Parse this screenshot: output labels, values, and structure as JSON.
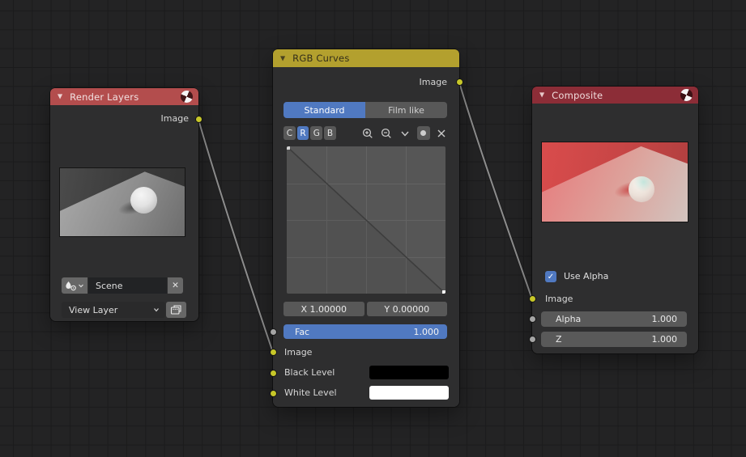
{
  "editor": {
    "type": "blender-compositor-node-editor",
    "background": "#232324",
    "grid_line": "#1b1b1c"
  },
  "colors": {
    "accent_blue": "#5079c1",
    "socket_yellow": "#c7c729",
    "socket_gray": "#a5a5a5",
    "node_body": "#2f2f30",
    "header_render_layers": "#b34d4d",
    "header_rgb_curves": "#b3a02e",
    "header_composite": "#8c2d37",
    "wire": "#8d8d8d",
    "black_level_swatch": "#000000",
    "white_level_swatch": "#ffffff"
  },
  "icons": {
    "collapse": "▼",
    "close": "✕",
    "check": "✓"
  },
  "links": [
    {
      "from": "render_layers.Image",
      "to": "rgb_curves.Image"
    },
    {
      "from": "rgb_curves.Image",
      "to": "composite.Image"
    }
  ],
  "nodes": {
    "render_layers": {
      "title": "Render Layers",
      "outputs": [
        {
          "label": "Image",
          "socket_color": "#c7c729"
        }
      ],
      "preview": "grayscale 3d scene: white sphere with shadow on gray floor plane",
      "scene_field": {
        "value": "Scene"
      },
      "view_layer_field": {
        "value": "View Layer"
      }
    },
    "rgb_curves": {
      "title": "RGB Curves",
      "outputs": [
        {
          "label": "Image",
          "socket_color": "#c7c729"
        }
      ],
      "tabs": [
        {
          "label": "Standard",
          "active": true
        },
        {
          "label": "Film like",
          "active": false
        }
      ],
      "channels": [
        {
          "label": "C",
          "active": false
        },
        {
          "label": "R",
          "active": true
        },
        {
          "label": "G",
          "active": false
        },
        {
          "label": "B",
          "active": false
        }
      ],
      "curve": {
        "points": [
          {
            "x": 0.0,
            "y": 1.0
          },
          {
            "x": 1.0,
            "y": 0.0
          }
        ],
        "selected_point": {
          "x": 1.0,
          "y": 0.0
        },
        "grid_divisions": 4
      },
      "x_field": "X 1.00000",
      "y_field": "Y 0.00000",
      "fac": {
        "label": "Fac",
        "value": "1.000"
      },
      "inputs": [
        {
          "label": "Image",
          "socket_color": "#c7c729"
        },
        {
          "label": "Black Level",
          "swatch": "#000000",
          "socket_color": "#c7c729"
        },
        {
          "label": "White Level",
          "swatch": "#ffffff",
          "socket_color": "#c7c729"
        }
      ]
    },
    "composite": {
      "title": "Composite",
      "use_alpha": {
        "label": "Use Alpha",
        "checked": true
      },
      "preview": "red-tinted 3d scene: white sphere with shadow on pink floor plane",
      "inputs": [
        {
          "label": "Image",
          "socket_color": "#c7c729"
        }
      ],
      "alpha": {
        "label": "Alpha",
        "value": "1.000"
      },
      "z": {
        "label": "Z",
        "value": "1.000"
      }
    }
  }
}
